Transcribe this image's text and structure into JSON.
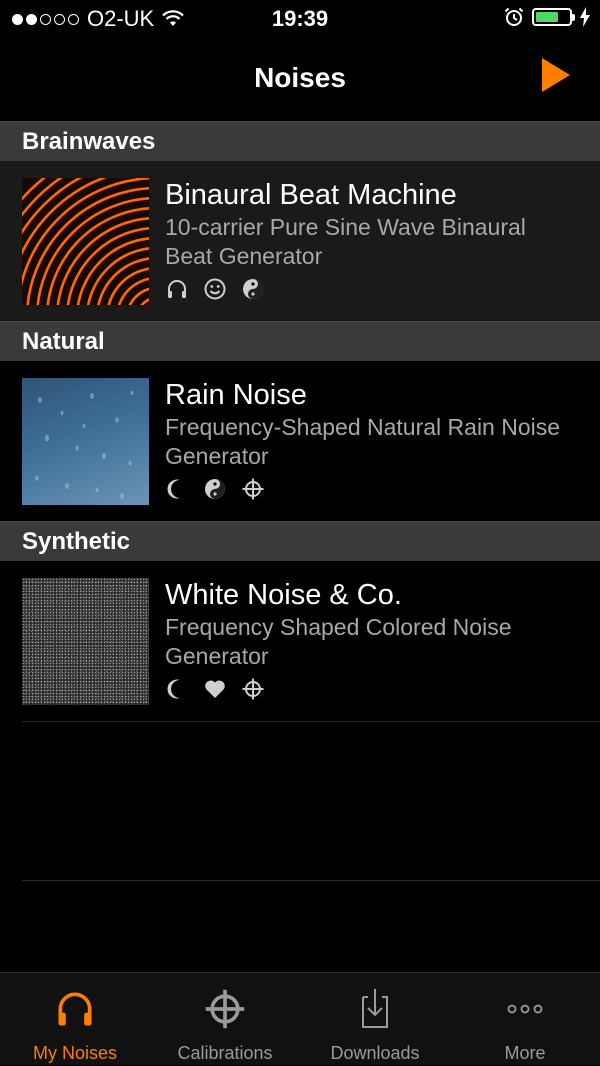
{
  "status_bar": {
    "carrier": "O2-UK",
    "time": "19:39",
    "signal_bars_filled": 2,
    "signal_bars_total": 5,
    "battery_level": 0.7
  },
  "navbar": {
    "title": "Noises",
    "play_button": "play-icon",
    "accent_color": "#ff7e00"
  },
  "sections": [
    {
      "header": "Brainwaves",
      "item": {
        "name": "Binaural Beat Machine",
        "description": "10-carrier Pure Sine Wave Binaural Beat Generator",
        "icons": [
          "headphones-icon",
          "smiley-icon",
          "yin-yang-icon"
        ]
      }
    },
    {
      "header": "Natural",
      "item": {
        "name": "Rain Noise",
        "description": "Frequency-Shaped Natural Rain Noise Generator",
        "icons": [
          "moon-icon",
          "yin-yang-icon",
          "crosshair-icon"
        ]
      }
    },
    {
      "header": "Synthetic",
      "item": {
        "name": "White Noise & Co.",
        "description": "Frequency Shaped Colored Noise Generator",
        "icons": [
          "moon-icon",
          "heart-icon",
          "crosshair-icon"
        ]
      }
    }
  ],
  "tabbar": {
    "tabs": [
      {
        "label": "My Noises",
        "icon": "headphones-icon",
        "active": true
      },
      {
        "label": "Calibrations",
        "icon": "crosshair-icon",
        "active": false
      },
      {
        "label": "Downloads",
        "icon": "download-icon",
        "active": false
      },
      {
        "label": "More",
        "icon": "more-icon",
        "active": false
      }
    ]
  }
}
